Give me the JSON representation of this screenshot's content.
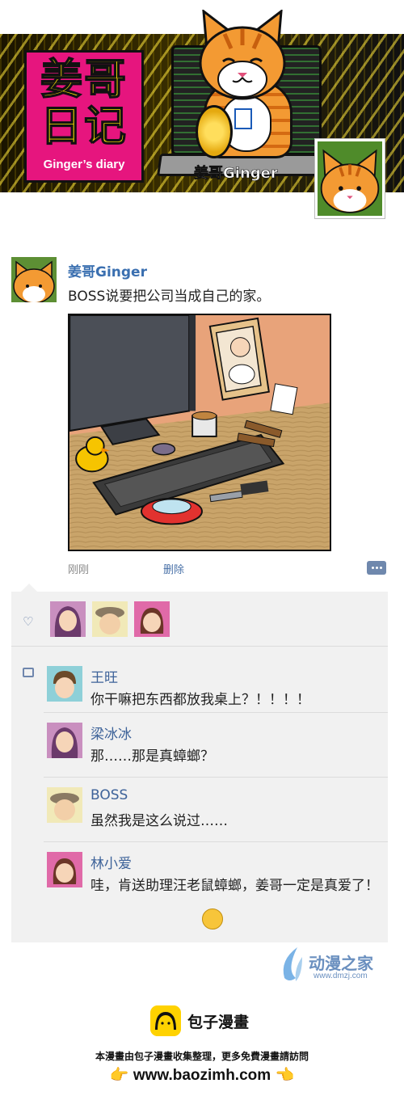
{
  "banner": {
    "title_line1": "姜哥",
    "title_line2": "日记",
    "subtitle": "Ginger’s diary",
    "character_name": "姜哥Ginger"
  },
  "post": {
    "author": "姜哥Ginger",
    "text": "BOSS说要把公司当成自己的家。",
    "time": "刚刚",
    "delete_label": "删除",
    "more_icon": "more-dots-icon"
  },
  "likes": {
    "icon": "heart-icon",
    "avatars": [
      "梁冰冰",
      "BOSS",
      "林小爱"
    ]
  },
  "comments": {
    "icon": "comment-icon",
    "items": [
      {
        "name": "王旺",
        "text": "你干嘛把东西都放我桌上？！！！！"
      },
      {
        "name": "梁冰冰",
        "text": "那……那是真蟑螂？"
      },
      {
        "name": "BOSS",
        "text": "虽然我是这么说过……"
      },
      {
        "name": "林小爱",
        "text": "哇，肯送助理汪老鼠蟑螂，姜哥一定是真爱了！"
      }
    ]
  },
  "watermark": {
    "name": "动漫之家",
    "url": "www.dmzj.com"
  },
  "footer": {
    "brand": "包子漫畫",
    "line": "本漫畫由包子漫畫收集整理，更多免費漫畫請訪問",
    "url": "www.baozimh.com",
    "pointer_left": "👉",
    "pointer_right": "👈"
  },
  "colors": {
    "name_blue": "#3d6299",
    "title_magenta": "#e6157e",
    "title_yellow": "#ffe600",
    "panel_bg": "#f1f1f1"
  }
}
